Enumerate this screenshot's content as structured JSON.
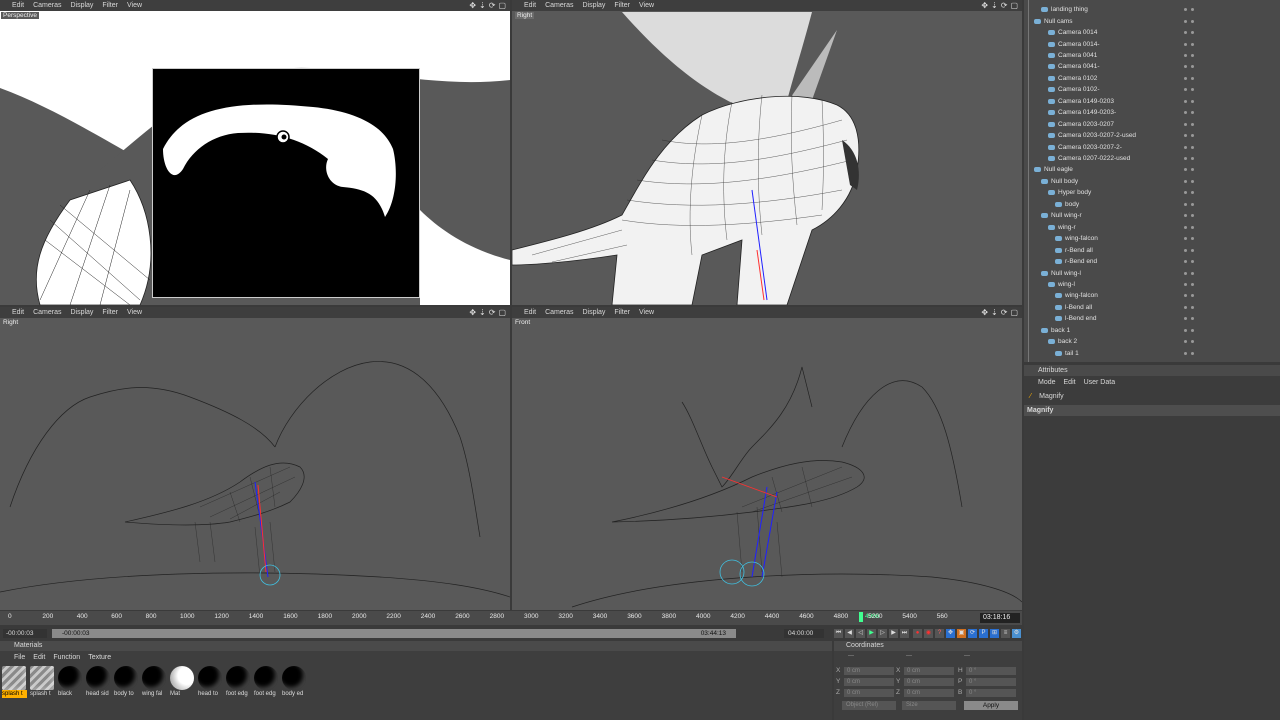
{
  "viewports": {
    "menu": [
      "Edit",
      "Cameras",
      "Display",
      "Filter",
      "View"
    ],
    "perspective": "Perspective",
    "right_top": "Right",
    "right_bottom": "Right",
    "front": "Front"
  },
  "object_manager": {
    "rows": [
      {
        "label": "landing thing",
        "indent": 1
      },
      {
        "label": "Null cams",
        "indent": 0
      },
      {
        "label": "Camera 0014",
        "indent": 2
      },
      {
        "label": "Camera 0014-",
        "indent": 2
      },
      {
        "label": "Camera 0041",
        "indent": 2
      },
      {
        "label": "Camera 0041-",
        "indent": 2
      },
      {
        "label": "Camera 0102",
        "indent": 2
      },
      {
        "label": "Camera 0102-",
        "indent": 2
      },
      {
        "label": "Camera 0149-0203",
        "indent": 2
      },
      {
        "label": "Camera 0149-0203-",
        "indent": 2
      },
      {
        "label": "Camera 0203-0207",
        "indent": 2
      },
      {
        "label": "Camera 0203-0207-2-used",
        "indent": 2
      },
      {
        "label": "Camera 0203-0207-2-",
        "indent": 2
      },
      {
        "label": "Camera 0207-0222-used",
        "indent": 2
      },
      {
        "label": "Null eagle",
        "indent": 0
      },
      {
        "label": "Null body",
        "indent": 1
      },
      {
        "label": "Hyper body",
        "indent": 2
      },
      {
        "label": "body",
        "indent": 3
      },
      {
        "label": "Null wing-r",
        "indent": 1
      },
      {
        "label": "wing-r",
        "indent": 2
      },
      {
        "label": "wing-falcon",
        "indent": 3
      },
      {
        "label": "r-Bend all",
        "indent": 3
      },
      {
        "label": "r-Bend end",
        "indent": 3
      },
      {
        "label": "Null wing-l",
        "indent": 1
      },
      {
        "label": "wing-l",
        "indent": 2
      },
      {
        "label": "wing-falcon",
        "indent": 3
      },
      {
        "label": "l-Bend all",
        "indent": 3
      },
      {
        "label": "l-Bend end",
        "indent": 3
      },
      {
        "label": "back 1",
        "indent": 1
      },
      {
        "label": "back 2",
        "indent": 2
      },
      {
        "label": "tail 1",
        "indent": 3
      }
    ]
  },
  "attributes": {
    "title": "Attributes",
    "menu": [
      "Mode",
      "Edit",
      "User Data"
    ],
    "tool": "Magnify",
    "section": "Magnify"
  },
  "timeline": {
    "ticks": [
      "0",
      "200",
      "400",
      "600",
      "800",
      "1000",
      "1200",
      "1400",
      "1600",
      "1800",
      "2000",
      "2200",
      "2400",
      "2600",
      "2800",
      "3000",
      "3200",
      "3400",
      "3600",
      "3800",
      "4000",
      "4200",
      "4400",
      "4600",
      "4800",
      "4966",
      "5200",
      "5400",
      "560"
    ],
    "current_frame": "4966",
    "current_time": "03:18:16",
    "start_time": "-00:00:03",
    "range_start": "-00:00:03",
    "range_end": "03:44:13",
    "end_time": "04:00:00"
  },
  "materials": {
    "title": "Materials",
    "menu": [
      "File",
      "Edit",
      "Function",
      "Texture"
    ],
    "items": [
      {
        "label": "splash t",
        "type": "hat",
        "selected": true
      },
      {
        "label": "splash t",
        "type": "hat"
      },
      {
        "label": "black",
        "type": "black"
      },
      {
        "label": "head sid",
        "type": "black"
      },
      {
        "label": "body to",
        "type": "black"
      },
      {
        "label": "wing fal",
        "type": "black"
      },
      {
        "label": "Mat",
        "type": "white"
      },
      {
        "label": "head to",
        "type": "black"
      },
      {
        "label": "foot edg",
        "type": "black"
      },
      {
        "label": "foot edg",
        "type": "black"
      },
      {
        "label": "body ed",
        "type": "black"
      }
    ]
  },
  "coordinates": {
    "title": "Coordinates",
    "header": [
      "---",
      "---",
      "---"
    ],
    "rows": [
      {
        "a": "X",
        "av": "0 cm",
        "b": "X",
        "bv": "0 cm",
        "c": "H",
        "cv": "0 °"
      },
      {
        "a": "Y",
        "av": "0 cm",
        "b": "Y",
        "bv": "0 cm",
        "c": "P",
        "cv": "0 °"
      },
      {
        "a": "Z",
        "av": "0 cm",
        "b": "Z",
        "bv": "0 cm",
        "c": "B",
        "cv": "0 °"
      }
    ],
    "mode_select": "Object (Rel)",
    "size_select": "Size",
    "apply": "Apply"
  },
  "colors": {
    "accent": "#ffb000",
    "check": "#67d86a",
    "keyframe": "#40ff90"
  }
}
